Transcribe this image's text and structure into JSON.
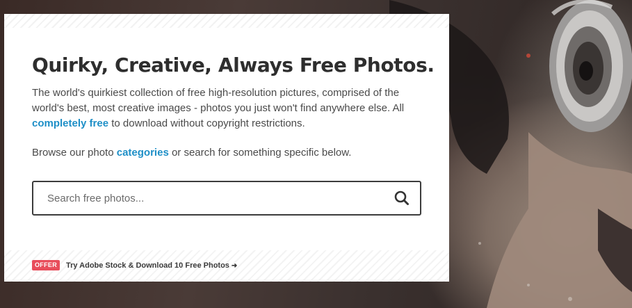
{
  "hero": {
    "background_description_icon": "quirky-photo-hero"
  },
  "intro_card": {
    "headline": "Quirky, Creative, Always Free Photos.",
    "intro_text_part1": "The world's quirkiest collection of free high-resolution pictures, comprised of the world's best, most creative images - photos you just won't find anywhere else. All ",
    "intro_link": "completely free",
    "intro_text_part2": " to download without copyright restrictions.",
    "browse_text_part1": "Browse our photo ",
    "browse_link": "categories",
    "browse_text_part2": " or search for something specific below."
  },
  "search": {
    "placeholder": "Search free photos...",
    "value": "",
    "icon": "search-icon"
  },
  "offer": {
    "badge": "OFFER",
    "link_text": "Try Adobe Stock & Download 10 Free Photos",
    "arrow_icon": "arrow-right-icon"
  },
  "colors": {
    "link": "#1e8fc7",
    "offer_badge": "#e84d5b",
    "headline": "#2e2e2e",
    "search_border": "#3c3c3c"
  }
}
